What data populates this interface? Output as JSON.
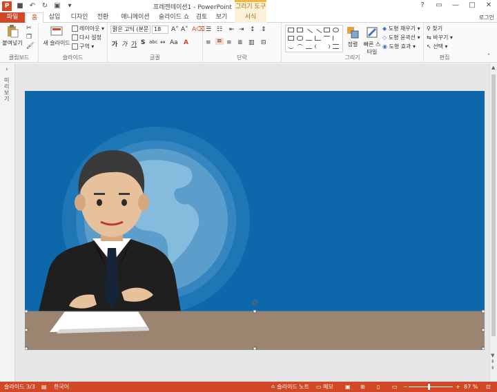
{
  "titlebar": {
    "logo": "P",
    "title": "프레젠테이션1 - PowerPoint",
    "context_tab_title": "그리기 도구",
    "help": "?",
    "controls": [
      "▭",
      "—",
      "□",
      "✕"
    ]
  },
  "tabs": {
    "file": "파일",
    "home": "홈",
    "insert": "삽입",
    "design": "디자인",
    "transitions": "전환",
    "animations": "애니메이션",
    "slideshow": "슬라이드 쇼",
    "review": "검토",
    "view": "보기",
    "format": "서식",
    "login": "로그인"
  },
  "ribbon": {
    "clipboard": {
      "label": "클립보드",
      "paste": "붙여넣기"
    },
    "slides": {
      "label": "슬라이드",
      "new_slide": "새 슬라이드",
      "layout": "레이아웃 ▾",
      "reset": "다시 설정",
      "section": "구역 ▾"
    },
    "font": {
      "label": "글꼴",
      "font_name": "맑은 고딕 (본문",
      "font_size": "18"
    },
    "paragraph": {
      "label": "단락"
    },
    "drawing": {
      "label": "그리기",
      "arrange": "정렬",
      "quick_styles": "빠른 스타일",
      "fill": "도형 채우기 ▾",
      "outline": "도형 윤곽선 ▾",
      "effects": "도형 효과 ▾"
    },
    "editing": {
      "label": "편집",
      "find": "찾기",
      "replace": "바꾸기 ▾",
      "select": "선택 ▾"
    }
  },
  "leftpanel": {
    "label": "미리보기"
  },
  "statusbar": {
    "slide_info": "슬라이드 3/3",
    "language": "한국어",
    "notes": "슬라이드 노트",
    "comments": "메모",
    "zoom": "87 %"
  },
  "colors": {
    "accent": "#d24726",
    "slide_bg": "#0c68ab",
    "desk": "#9b8571",
    "globe": "#5b9ecb",
    "suit": "#1f1f1f",
    "skin": "#e7c09c",
    "hair": "#3a3a3a"
  }
}
